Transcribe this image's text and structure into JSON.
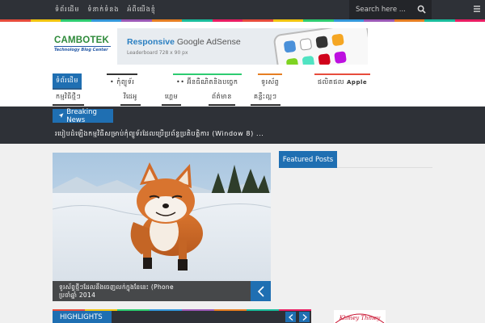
{
  "topbar": {
    "links": [
      "ទំព័រដើម",
      "ទំនាក់ទំនង",
      "អំពីយើងខ្ញុំ"
    ],
    "search_placeholder": "Search here ...",
    "icons": [
      "search-icon",
      "menu-icon"
    ]
  },
  "colors": {
    "accent": "#1f6fb2",
    "dark": "#2e3137",
    "strip": [
      "#e74c3c",
      "#f1c40f",
      "#2ecc71",
      "#3498db",
      "#9b59b6",
      "#e67e22",
      "#1abc9c",
      "#e91e63"
    ]
  },
  "header": {
    "logo_text": "CAMBOTEK",
    "logo_tagline": "Technology Blog Center",
    "ad_title_bold": "Responsive",
    "ad_title_rest": " Google AdSense",
    "ad_subtitle": "Leaderboard 728 x 90 px"
  },
  "nav": {
    "row1": [
      {
        "label": "ទំព័រដើម",
        "active": true
      },
      {
        "label": "• កុំព្យូទ័រ",
        "active": false
      },
      {
        "label": "•• អ៊ីនធឺណិតនិងបច្ចេក",
        "active": false
      },
      {
        "label": "ទូរស័ព្ទ",
        "active": false
      },
      {
        "label": "ផលិតផល",
        "active": false,
        "suffix": "Apple"
      }
    ],
    "row2": [
      "កម្មវិធីថ្មីៗ",
      "វីដេអូ",
      "ហ្គេម",
      "ព័ត៌មាន",
      "គន្លឹះល្អៗ"
    ]
  },
  "breaking": {
    "label": "Breaking News",
    "ticker": "របៀបដំឡើងកម្មវិធីសម្រាប់កុំព្យូទ័រដែលប្រើប្រព័ន្ធប្រតិបត្តិការ (Window 8) ..."
  },
  "hero": {
    "caption_line1": "ទូរស័ព្ទថ្មីៗដែលនឹងចេញលក់ក្នុងខែនេះ (Phone",
    "caption_line2": "ប្រចាំឆ្នាំ 2014"
  },
  "featured": {
    "label": "Featured Posts"
  },
  "highlights": {
    "label": "HIGHLIGHTS"
  },
  "badge": {
    "text": "Khmey Thmey"
  }
}
